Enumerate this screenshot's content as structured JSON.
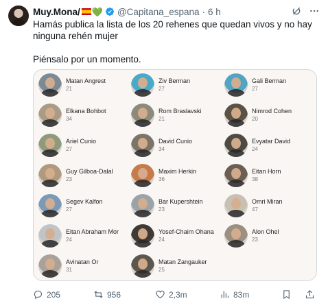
{
  "post": {
    "author_name": "Muy.Mona/",
    "handle": "@Capitana_espana",
    "separator": "·",
    "time": "6 h",
    "heart": "💚",
    "text": "Hamás publica la lista de los 20 rehenes que quedan vivos y no hay ninguna rehén mujer\n\nPiénsalo por un momento."
  },
  "hostages": [
    {
      "name": "Matan Angrest",
      "age": "21",
      "tone": "#7b8a94"
    },
    {
      "name": "Ziv Berman",
      "age": "27",
      "tone": "#4aa8c9"
    },
    {
      "name": "Gali Berman",
      "age": "27",
      "tone": "#52a3c4"
    },
    {
      "name": "Elkana Bohbot",
      "age": "34",
      "tone": "#a99b86"
    },
    {
      "name": "Rom Braslavski",
      "age": "21",
      "tone": "#8c8a7a"
    },
    {
      "name": "Nimrod Cohen",
      "age": "20",
      "tone": "#5b5246"
    },
    {
      "name": "Ariel Cunio",
      "age": "27",
      "tone": "#8d9a7b"
    },
    {
      "name": "David Cunio",
      "age": "34",
      "tone": "#7d7468"
    },
    {
      "name": "Evyatar David",
      "age": "24",
      "tone": "#4e4a44"
    },
    {
      "name": "Guy Gilboa-Dalal",
      "age": "23",
      "tone": "#b09a7e"
    },
    {
      "name": "Maxim Herkin",
      "age": "36",
      "tone": "#c77a4a"
    },
    {
      "name": "Eitan Horn",
      "age": "38",
      "tone": "#6b5f54"
    },
    {
      "name": "Segev Kalfon",
      "age": "27",
      "tone": "#7a9ab8"
    },
    {
      "name": "Bar Kupershtein",
      "age": "23",
      "tone": "#9aa3a8"
    },
    {
      "name": "Omri Miran",
      "age": "47",
      "tone": "#c8c0b2"
    },
    {
      "name": "Eitan Abraham Mor",
      "age": "24",
      "tone": "#bfc4c8"
    },
    {
      "name": "Yosef-Chaim Ohana",
      "age": "24",
      "tone": "#3f3a36"
    },
    {
      "name": "Alon Ohel",
      "age": "23",
      "tone": "#9c8f80"
    },
    {
      "name": "Avinatan Or",
      "age": "31",
      "tone": "#a8a29a"
    },
    {
      "name": "Matan Zangauker",
      "age": "25",
      "tone": "#5d564f"
    }
  ],
  "actions": {
    "replies": "205",
    "reposts": "956",
    "likes": "2,3m",
    "views": "83m"
  },
  "colors": {
    "text": "#0f1419",
    "secondary": "#536471",
    "verified": "#1d9bf0",
    "card_bg": "#faf6f4"
  }
}
